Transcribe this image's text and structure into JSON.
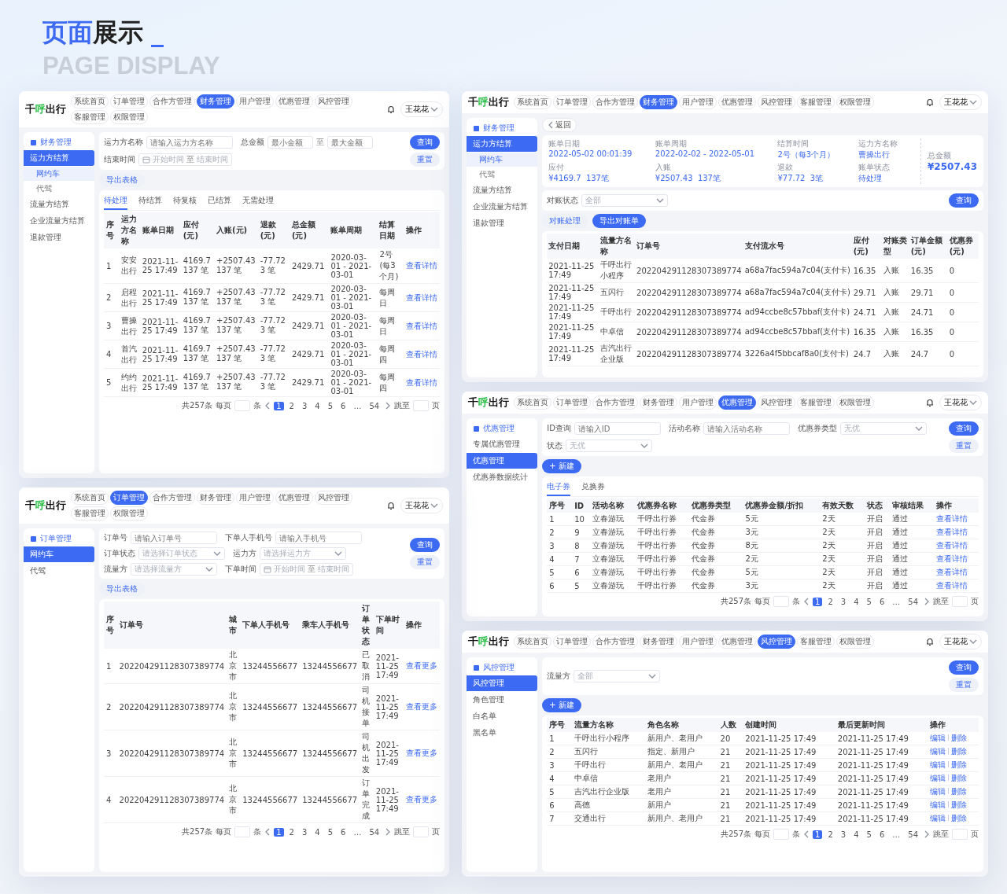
{
  "heading": {
    "accent": "页面",
    "main": "展示",
    "cursor": "_"
  },
  "subheading": "PAGE DISPLAY",
  "screens": [
    {
      "logo": "千呼出行",
      "user": "王花花",
      "nav": [
        {
          "label": "系统首页",
          "selected": false
        },
        {
          "label": "订单管理",
          "selected": false
        },
        {
          "label": "合作方管理",
          "selected": false
        },
        {
          "label": "财务管理",
          "selected": true
        },
        {
          "label": "用户管理",
          "selected": false
        },
        {
          "label": "优惠管理",
          "selected": false
        },
        {
          "label": "风控管理",
          "selected": false
        },
        {
          "label": "客服管理",
          "selected": false
        },
        {
          "label": "权限管理",
          "selected": false
        }
      ],
      "sidebar": {
        "title": "财务管理",
        "items": [
          {
            "label": "运力方结算",
            "selected": true,
            "children": [
              {
                "label": "网约车",
                "selected": true
              },
              {
                "label": "代驾",
                "selected": false
              }
            ]
          },
          {
            "label": "流量方结算",
            "selected": false
          },
          {
            "label": "企业流量方结算",
            "selected": false
          },
          {
            "label": "退款管理",
            "selected": false
          }
        ]
      },
      "filters": [
        {
          "kind": "input",
          "label": "运力方名称",
          "placeholder": "请输入运力方名称"
        },
        {
          "kind": "range",
          "label": "总金额",
          "placeholder": "最小金额",
          "to": "至",
          "placeholder_2": "最大金额"
        },
        {
          "kind": "date",
          "label": "结束时间",
          "placeholder": "开始时间",
          "to": "至",
          "placeholder_2": "结束时间"
        }
      ],
      "actions": [
        {
          "label": "查询",
          "kind": "primary"
        },
        {
          "label": "重置",
          "kind": "secondary"
        }
      ],
      "tools": [
        {
          "label": "导出表格",
          "kind": "secondary"
        }
      ],
      "tabs": [
        {
          "label": "待处理",
          "selected": true
        },
        {
          "label": "待结算",
          "selected": false
        },
        {
          "label": "待复核",
          "selected": false
        },
        {
          "label": "已结算",
          "selected": false
        },
        {
          "label": "无需处理",
          "selected": false
        }
      ],
      "columns": [
        {
          "label": "序号",
          "kind": "text"
        },
        {
          "label": "运力方名称",
          "kind": "text"
        },
        {
          "label": "账单日期",
          "kind": "text"
        },
        {
          "label": "应付(元)",
          "kind": "text"
        },
        {
          "label": "入账(元)",
          "kind": "text"
        },
        {
          "label": "退款(元)",
          "kind": "text"
        },
        {
          "label": "总金额(元)",
          "kind": "text"
        },
        {
          "label": "账单周期",
          "kind": "text"
        },
        {
          "label": "结算日期",
          "kind": "text"
        },
        {
          "label": "操作",
          "kind": "link"
        }
      ],
      "rows": [
        [
          "1",
          "安安出行",
          "2021-11-25 17:49",
          "4169.7\n137 笔",
          "+2507.43\n137 笔",
          "-77.72\n3 笔",
          "2429.71",
          "2020-03-01 - 2021-03-01",
          "2号 (每3个月)",
          "查看详情"
        ],
        [
          "2",
          "启程出行",
          "2021-11-25 17:49",
          "4169.7\n137 笔",
          "+2507.43\n137 笔",
          "-77.72\n3 笔",
          "2429.71",
          "2020-03-01 - 2021-03-01",
          "每周日",
          "查看详情"
        ],
        [
          "3",
          "曹操出行",
          "2021-11-25 17:49",
          "4169.7\n137 笔",
          "+2507.43\n137 笔",
          "-77.72\n3 笔",
          "2429.71",
          "2020-03-01 - 2021-03-01",
          "每周日",
          "查看详情"
        ],
        [
          "4",
          "首汽出行",
          "2021-11-25 17:49",
          "4169.7\n137 笔",
          "+2507.43\n137 笔",
          "-77.72\n3 笔",
          "2429.71",
          "2020-03-01 - 2021-03-01",
          "每周四",
          "查看详情"
        ],
        [
          "5",
          "约约出行",
          "2021-11-25 17:49",
          "4169.7\n137 笔",
          "+2507.43\n137 笔",
          "-77.72\n3 笔",
          "2429.71",
          "2020-03-01 - 2021-03-01",
          "每周四",
          "查看详情"
        ]
      ],
      "pagination": {
        "total": "共257条",
        "per_page": "每页",
        "unit": "条",
        "pages": [
          {
            "label": "1",
            "selected": true
          },
          {
            "label": "2",
            "selected": false
          },
          {
            "label": "3",
            "selected": false
          },
          {
            "label": "4",
            "selected": false
          },
          {
            "label": "5",
            "selected": false
          },
          {
            "label": "6",
            "selected": false
          },
          {
            "label": "…",
            "selected": false
          },
          {
            "label": "54",
            "selected": false
          }
        ],
        "jump": "跳至",
        "page_unit": "页"
      }
    },
    {
      "logo": "千呼出行",
      "user": "王花花",
      "nav": [
        {
          "label": "系统首页",
          "selected": false
        },
        {
          "label": "订单管理",
          "selected": false
        },
        {
          "label": "合作方管理",
          "selected": false
        },
        {
          "label": "财务管理",
          "selected": true
        },
        {
          "label": "用户管理",
          "selected": false
        },
        {
          "label": "优惠管理",
          "selected": false
        },
        {
          "label": "风控管理",
          "selected": false
        },
        {
          "label": "客服管理",
          "selected": false
        },
        {
          "label": "权限管理",
          "selected": false
        }
      ],
      "sidebar": {
        "title": "财务管理",
        "items": [
          {
            "label": "运力方结算",
            "selected": true,
            "children": [
              {
                "label": "网约车",
                "selected": true
              },
              {
                "label": "代驾",
                "selected": false
              }
            ]
          },
          {
            "label": "流量方结算",
            "selected": false
          },
          {
            "label": "企业流量方结算",
            "selected": false
          },
          {
            "label": "退款管理",
            "selected": false
          }
        ]
      },
      "back": "返回",
      "summary": [
        {
          "label": "账单日期",
          "value": "2022-05-02 00:01:39"
        },
        {
          "label": "账单周期",
          "value": "2022-02-02 - 2022-05-01"
        },
        {
          "label": "结算时间",
          "value": "2号（每3个月）"
        },
        {
          "label": "运力方名称",
          "value": "曹操出行"
        },
        {
          "label": "应付",
          "value": "¥4169.7  137笔"
        },
        {
          "label": "入账",
          "value": "¥2507.43  137笔"
        },
        {
          "label": "退款",
          "value": "¥77.72  3笔"
        },
        {
          "label": "账单状态",
          "value": "待处理"
        }
      ],
      "total": {
        "label": "总金额",
        "value": "¥2507.43"
      },
      "filters": [
        {
          "kind": "select",
          "label": "对账状态",
          "placeholder": "全部"
        }
      ],
      "actions": [
        {
          "label": "查询",
          "kind": "primary"
        }
      ],
      "tools": [
        {
          "label": "对账处理",
          "kind": "secondary"
        },
        {
          "label": "导出对账单",
          "kind": "primary"
        }
      ],
      "columns": [
        {
          "label": "支付日期",
          "kind": "text"
        },
        {
          "label": "流量方名称",
          "kind": "text"
        },
        {
          "label": "订单号",
          "kind": "text"
        },
        {
          "label": "支付流水号",
          "kind": "text"
        },
        {
          "label": "应付(元)",
          "kind": "text"
        },
        {
          "label": "对账类型",
          "kind": "text"
        },
        {
          "label": "订单金额(元)",
          "kind": "text"
        },
        {
          "label": "优惠券(元)",
          "kind": "text"
        }
      ],
      "rows": [
        [
          "2021-11-25 17:49",
          "千呼出行小程序",
          "202204291128307389774",
          "a68a7fac594a7c04(支付卡)",
          "16.35",
          "入账",
          "16.35",
          "0"
        ],
        [
          "2021-11-25 17:49",
          "五闪行",
          "202204291128307389774",
          "a68a7fac594a7c04(支付卡)",
          "29.71",
          "入账",
          "29.71",
          "0"
        ],
        [
          "2021-11-25 17:49",
          "千呼出行",
          "202204291128307389774",
          "ad94ccbe8c57bbaf(支付卡)",
          "24.71",
          "入账",
          "24.71",
          "0"
        ],
        [
          "2021-11-25 17:49",
          "中卓信",
          "202204291128307389774",
          "ad94ccbe8c57bbaf(支付卡)",
          "16.35",
          "入账",
          "16.35",
          "0"
        ],
        [
          "2021-11-25 17:49",
          "吉汽出行企业版",
          "202204291128307389774",
          "3226a4f5bbcaf8a0(支付卡)",
          "24.7",
          "入账",
          "24.7",
          "0"
        ]
      ]
    },
    {
      "logo": "千呼出行",
      "user": "王花花",
      "nav": [
        {
          "label": "系统首页",
          "selected": false
        },
        {
          "label": "订单管理",
          "selected": false
        },
        {
          "label": "合作方管理",
          "selected": false
        },
        {
          "label": "财务管理",
          "selected": false
        },
        {
          "label": "用户管理",
          "selected": false
        },
        {
          "label": "优惠管理",
          "selected": true
        },
        {
          "label": "风控管理",
          "selected": false
        },
        {
          "label": "客服管理",
          "selected": false
        },
        {
          "label": "权限管理",
          "selected": false
        }
      ],
      "sidebar": {
        "title": "优惠管理",
        "items": [
          {
            "label": "专属优惠管理",
            "selected": false
          },
          {
            "label": "优惠管理",
            "selected": true
          },
          {
            "label": "优惠券数据统计",
            "selected": false
          }
        ]
      },
      "filters": [
        {
          "kind": "input",
          "label": "ID查询",
          "placeholder": "请输入ID"
        },
        {
          "kind": "input",
          "label": "活动名称",
          "placeholder": "请输入活动名称"
        },
        {
          "kind": "select",
          "label": "优惠券类型",
          "placeholder": "无优"
        },
        {
          "kind": "select",
          "label": "状态",
          "placeholder": "无优"
        }
      ],
      "actions": [
        {
          "label": "查询",
          "kind": "primary"
        },
        {
          "label": "重置",
          "kind": "secondary"
        }
      ],
      "tools": [
        {
          "label": "+ 新建",
          "kind": "primary"
        }
      ],
      "tabs": [
        {
          "label": "电子券",
          "selected": true
        },
        {
          "label": "兑换券",
          "selected": false
        }
      ],
      "columns": [
        {
          "label": "序号",
          "kind": "text"
        },
        {
          "label": "ID",
          "kind": "text"
        },
        {
          "label": "活动名称",
          "kind": "text"
        },
        {
          "label": "优惠券名称",
          "kind": "text"
        },
        {
          "label": "优惠券类型",
          "kind": "text"
        },
        {
          "label": "优惠券金额/折扣",
          "kind": "text"
        },
        {
          "label": "有效天数",
          "kind": "text"
        },
        {
          "label": "状态",
          "kind": "text"
        },
        {
          "label": "审核结果",
          "kind": "text"
        },
        {
          "label": "操作",
          "kind": "link"
        }
      ],
      "rows": [
        [
          "1",
          "10",
          "立春游玩",
          "千呼出行券",
          "代金券",
          "5元",
          "2天",
          "开启",
          "通过",
          "查看详情"
        ],
        [
          "2",
          "9",
          "立春游玩",
          "千呼出行券",
          "代金券",
          "3元",
          "2天",
          "开启",
          "通过",
          "查看详情"
        ],
        [
          "3",
          "8",
          "立春游玩",
          "千呼出行券",
          "代金券",
          "8元",
          "2天",
          "开启",
          "通过",
          "查看详情"
        ],
        [
          "4",
          "7",
          "立春游玩",
          "千呼出行券",
          "代金券",
          "2元",
          "2天",
          "开启",
          "通过",
          "查看详情"
        ],
        [
          "5",
          "6",
          "立春游玩",
          "千呼出行券",
          "代金券",
          "5元",
          "2天",
          "开启",
          "通过",
          "查看详情"
        ],
        [
          "6",
          "5",
          "立春游玩",
          "千呼出行券",
          "代金券",
          "3元",
          "2天",
          "开启",
          "通过",
          "查看详情"
        ]
      ],
      "pagination": {
        "total": "共257条",
        "per_page": "每页",
        "unit": "条",
        "pages": [
          {
            "label": "1",
            "selected": true
          },
          {
            "label": "2",
            "selected": false
          },
          {
            "label": "3",
            "selected": false
          },
          {
            "label": "4",
            "selected": false
          },
          {
            "label": "5",
            "selected": false
          },
          {
            "label": "6",
            "selected": false
          },
          {
            "label": "…",
            "selected": false
          },
          {
            "label": "54",
            "selected": false
          }
        ],
        "jump": "跳至",
        "page_unit": "页"
      }
    },
    {
      "logo": "千呼出行",
      "user": "王花花",
      "nav": [
        {
          "label": "系统首页",
          "selected": false
        },
        {
          "label": "订单管理",
          "selected": true
        },
        {
          "label": "合作方管理",
          "selected": false
        },
        {
          "label": "财务管理",
          "selected": false
        },
        {
          "label": "用户管理",
          "selected": false
        },
        {
          "label": "优惠管理",
          "selected": false
        },
        {
          "label": "风控管理",
          "selected": false
        },
        {
          "label": "客服管理",
          "selected": false
        },
        {
          "label": "权限管理",
          "selected": false
        }
      ],
      "sidebar": {
        "title": "订单管理",
        "items": [
          {
            "label": "网约车",
            "selected": true
          },
          {
            "label": "代驾",
            "selected": false
          }
        ]
      },
      "filters": [
        {
          "kind": "input",
          "label": "订单号",
          "placeholder": "请输入订单号"
        },
        {
          "kind": "input",
          "label": "下单人手机号",
          "placeholder": "请输入手机号"
        },
        {
          "kind": "select",
          "label": "订单状态",
          "placeholder": "请选择订单状态"
        },
        {
          "kind": "select",
          "label": "运力方",
          "placeholder": "请选择运力方"
        },
        {
          "kind": "select",
          "label": "流量方",
          "placeholder": "请选择流量方"
        },
        {
          "kind": "date",
          "label": "下单时间",
          "placeholder": "开始时间",
          "to": "至",
          "placeholder_2": "结束时间"
        }
      ],
      "actions": [
        {
          "label": "查询",
          "kind": "primary"
        },
        {
          "label": "重置",
          "kind": "secondary"
        }
      ],
      "tools": [
        {
          "label": "导出表格",
          "kind": "secondary"
        }
      ],
      "columns": [
        {
          "label": "序号",
          "kind": "text"
        },
        {
          "label": "订单号",
          "kind": "text"
        },
        {
          "label": "城市",
          "kind": "text"
        },
        {
          "label": "下单人手机号",
          "kind": "text"
        },
        {
          "label": "乘车人手机号",
          "kind": "text"
        },
        {
          "label": "订单状态",
          "kind": "text"
        },
        {
          "label": "下单时间",
          "kind": "text"
        },
        {
          "label": "操作",
          "kind": "link"
        }
      ],
      "rows": [
        [
          "1",
          "202204291128307389774",
          "北京市",
          "13244556677",
          "13244556677",
          "已取消",
          "2021-11-25 17:49",
          "查看更多"
        ],
        [
          "2",
          "202204291128307389774",
          "北京市",
          "13244556677",
          "13244556677",
          "司机接单",
          "2021-11-25 17:49",
          "查看更多"
        ],
        [
          "3",
          "202204291128307389774",
          "北京市",
          "13244556677",
          "13244556677",
          "司机出发",
          "2021-11-25 17:49",
          "查看更多"
        ],
        [
          "4",
          "202204291128307389774",
          "北京市",
          "13244556677",
          "13244556677",
          "订单完成",
          "2021-11-25 17:49",
          "查看更多"
        ]
      ],
      "pagination": {
        "total": "共257条",
        "per_page": "每页",
        "unit": "条",
        "pages": [
          {
            "label": "1",
            "selected": true
          },
          {
            "label": "2",
            "selected": false
          },
          {
            "label": "3",
            "selected": false
          },
          {
            "label": "4",
            "selected": false
          },
          {
            "label": "5",
            "selected": false
          },
          {
            "label": "6",
            "selected": false
          },
          {
            "label": "…",
            "selected": false
          },
          {
            "label": "54",
            "selected": false
          }
        ],
        "jump": "跳至",
        "page_unit": "页"
      }
    },
    {
      "logo": "千呼出行",
      "user": "王花花",
      "nav": [
        {
          "label": "系统首页",
          "selected": false
        },
        {
          "label": "订单管理",
          "selected": false
        },
        {
          "label": "合作方管理",
          "selected": false
        },
        {
          "label": "财务管理",
          "selected": false
        },
        {
          "label": "用户管理",
          "selected": false
        },
        {
          "label": "优惠管理",
          "selected": false
        },
        {
          "label": "风控管理",
          "selected": true
        },
        {
          "label": "客服管理",
          "selected": false
        },
        {
          "label": "权限管理",
          "selected": false
        }
      ],
      "sidebar": {
        "title": "风控管理",
        "items": [
          {
            "label": "风控管理",
            "selected": true
          },
          {
            "label": "角色管理",
            "selected": false
          },
          {
            "label": "白名单",
            "selected": false
          },
          {
            "label": "黑名单",
            "selected": false
          }
        ]
      },
      "filters": [
        {
          "kind": "select",
          "label": "流量方",
          "placeholder": "全部"
        }
      ],
      "actions": [
        {
          "label": "查询",
          "kind": "primary"
        },
        {
          "label": "重置",
          "kind": "secondary"
        }
      ],
      "tools": [
        {
          "label": "+ 新建",
          "kind": "primary"
        }
      ],
      "columns": [
        {
          "label": "序号",
          "kind": "text"
        },
        {
          "label": "流量方名称",
          "kind": "text"
        },
        {
          "label": "角色名称",
          "kind": "text"
        },
        {
          "label": "人数",
          "kind": "text"
        },
        {
          "label": "创建时间",
          "kind": "text"
        },
        {
          "label": "最后更新时间",
          "kind": "text"
        },
        {
          "label": "操作",
          "kind": "links"
        }
      ],
      "rows": [
        [
          "1",
          "千呼出行小程序",
          "新用户、老用户",
          "20",
          "2021-11-25 17:49",
          "2021-11-25 17:49",
          [
            "编辑",
            "删除"
          ]
        ],
        [
          "2",
          "五闪行",
          "指定、新用户",
          "21",
          "2021-11-25 17:49",
          "2021-11-25 17:49",
          [
            "编辑",
            "删除"
          ]
        ],
        [
          "3",
          "千呼出行",
          "新用户、老用户",
          "21",
          "2021-11-25 17:49",
          "2021-11-25 17:49",
          [
            "编辑",
            "删除"
          ]
        ],
        [
          "4",
          "中卓信",
          "老用户",
          "21",
          "2021-11-25 17:49",
          "2021-11-25 17:49",
          [
            "编辑",
            "删除"
          ]
        ],
        [
          "5",
          "吉汽出行企业版",
          "老用户",
          "21",
          "2021-11-25 17:49",
          "2021-11-25 17:49",
          [
            "编辑",
            "删除"
          ]
        ],
        [
          "6",
          "高德",
          "新用户",
          "21",
          "2021-11-25 17:49",
          "2021-11-25 17:49",
          [
            "编辑",
            "删除"
          ]
        ],
        [
          "7",
          "交通出行",
          "新用户、老用户",
          "21",
          "2021-11-25 17:49",
          "2021-11-25 17:49",
          [
            "编辑",
            "删除"
          ]
        ]
      ],
      "pagination": {
        "total": "共257条",
        "per_page": "每页",
        "unit": "条",
        "pages": [
          {
            "label": "1",
            "selected": true
          },
          {
            "label": "2",
            "selected": false
          },
          {
            "label": "3",
            "selected": false
          },
          {
            "label": "4",
            "selected": false
          },
          {
            "label": "5",
            "selected": false
          },
          {
            "label": "6",
            "selected": false
          },
          {
            "label": "…",
            "selected": false
          },
          {
            "label": "54",
            "selected": false
          }
        ],
        "jump": "跳至",
        "page_unit": "页"
      }
    }
  ]
}
